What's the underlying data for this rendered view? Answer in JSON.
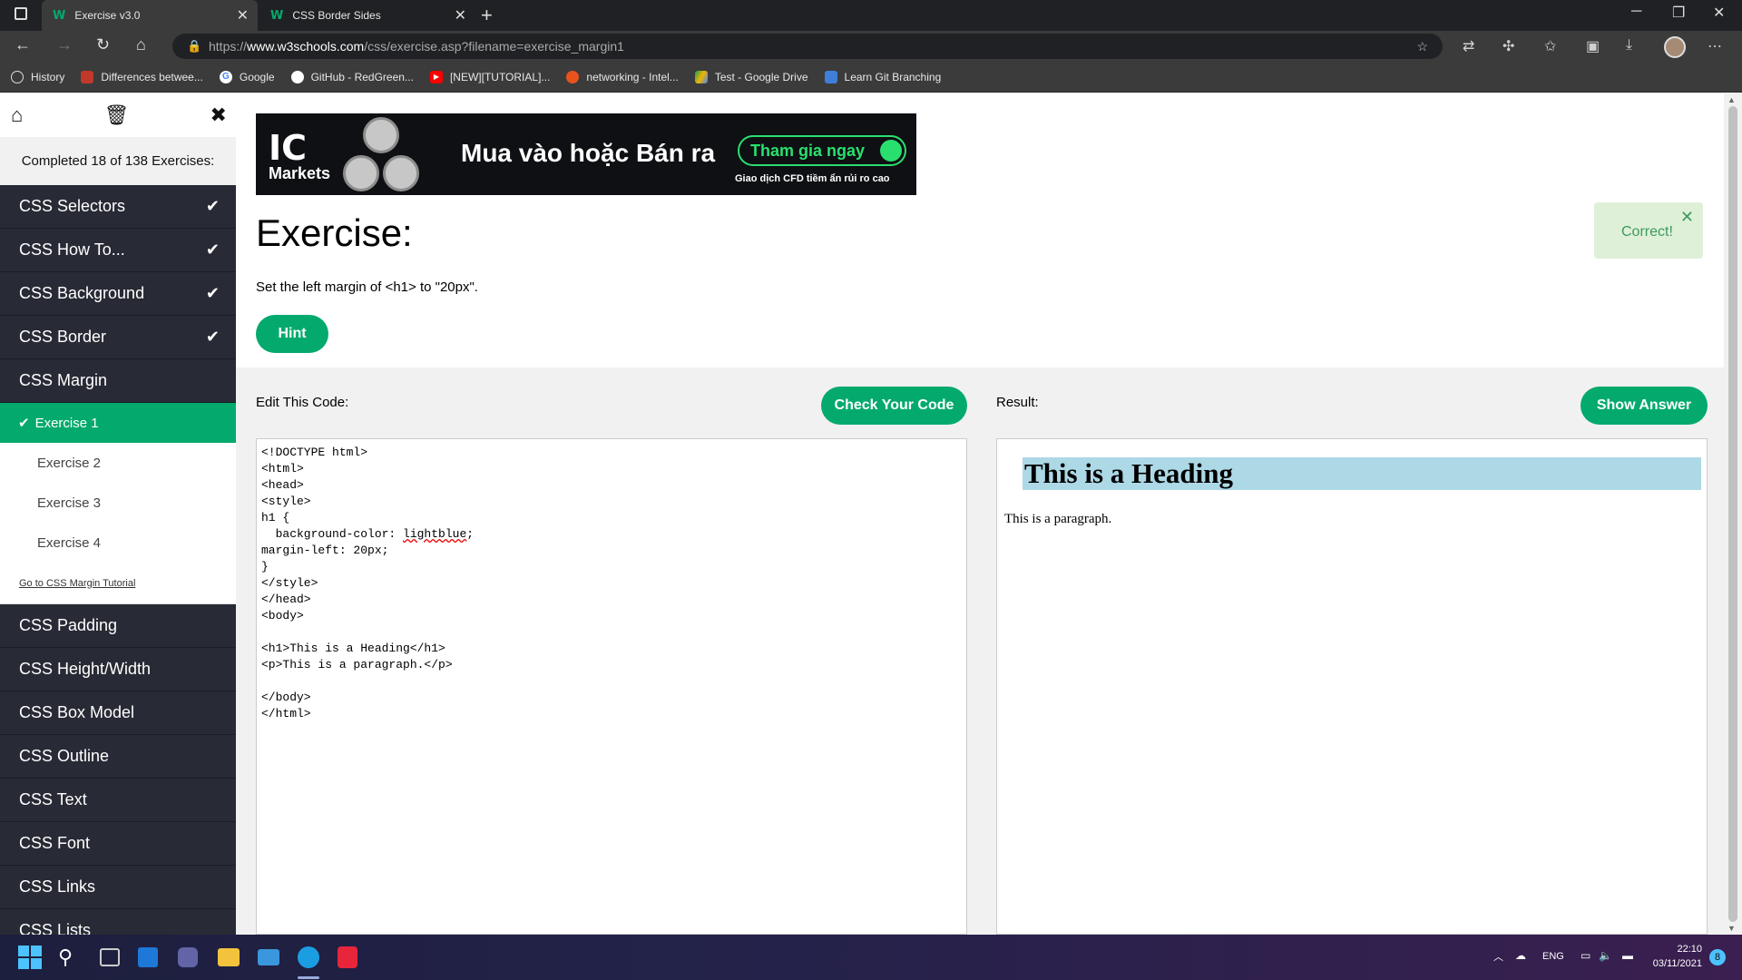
{
  "browser": {
    "tabs": [
      {
        "title": "Exercise v3.0",
        "favicon": "w3schools-icon"
      },
      {
        "title": "CSS Border Sides",
        "favicon": "w3schools-icon"
      }
    ],
    "url_prefix": "https://",
    "url_host": "www.w3schools.com",
    "url_path": "/css/exercise.asp?filename=exercise_margin1",
    "bookmarks": [
      {
        "label": "History",
        "icon": "history-icon"
      },
      {
        "label": "Differences betwee...",
        "icon": "bookmark-icon"
      },
      {
        "label": "Google",
        "icon": "google-icon"
      },
      {
        "label": "GitHub - RedGreen...",
        "icon": "github-icon"
      },
      {
        "label": "[NEW][TUTORIAL]...",
        "icon": "youtube-icon"
      },
      {
        "label": "networking - Intel...",
        "icon": "ask-icon"
      },
      {
        "label": "Test - Google Drive",
        "icon": "drive-icon"
      },
      {
        "label": "Learn Git Branching",
        "icon": "git-icon"
      }
    ]
  },
  "sidebar": {
    "progress": "Completed 18 of 138 Exercises:",
    "sections_before": [
      {
        "label": "CSS Selectors",
        "done": true
      },
      {
        "label": "CSS How To...",
        "done": true
      },
      {
        "label": "CSS Background",
        "done": true
      },
      {
        "label": "CSS Border",
        "done": true
      },
      {
        "label": "CSS Margin",
        "done": false
      }
    ],
    "exercises": [
      "Exercise 1",
      "Exercise 2",
      "Exercise 3",
      "Exercise 4"
    ],
    "tutorial_link": "Go to CSS Margin Tutorial",
    "sections_after": [
      "CSS Padding",
      "CSS Height/Width",
      "CSS Box Model",
      "CSS Outline",
      "CSS Text",
      "CSS Font",
      "CSS Links",
      "CSS Lists"
    ]
  },
  "ad": {
    "logo_text": "IC",
    "logo_sub": "Markets",
    "headline": "Mua vào hoặc Bán ra",
    "cta": "Tham gia ngay",
    "disclaimer": "Giao dịch CFD tiềm ẩn rủi ro cao"
  },
  "exercise": {
    "title": "Exercise:",
    "instruction": "Set the left margin of <h1> to \"20px\".",
    "hint_label": "Hint",
    "toast": "Correct!",
    "edit_label": "Edit This Code:",
    "check_label": "Check Your Code",
    "result_label": "Result:",
    "answer_label": "Show Answer",
    "code_before": "<!DOCTYPE html>\n<html>\n<head>\n<style>\nh1 {\n  background-color: ",
    "code_squiggle": "lightblue",
    "code_after": ";\nmargin-left: 20px;\n}\n</style>\n</head>\n<body>\n\n<h1>This is a Heading</h1>\n<p>This is a paragraph.</p>\n\n</body>\n</html>",
    "result_heading": "This is a Heading",
    "result_paragraph": "This is a paragraph."
  },
  "taskbar": {
    "lang": "ENG",
    "time": "22:10",
    "date": "03/11/2021",
    "badge": "8"
  },
  "colors": {
    "accent": "#04aa6d",
    "sidebar_bg": "#282a35",
    "result_h1_bg": "#add8e6"
  }
}
